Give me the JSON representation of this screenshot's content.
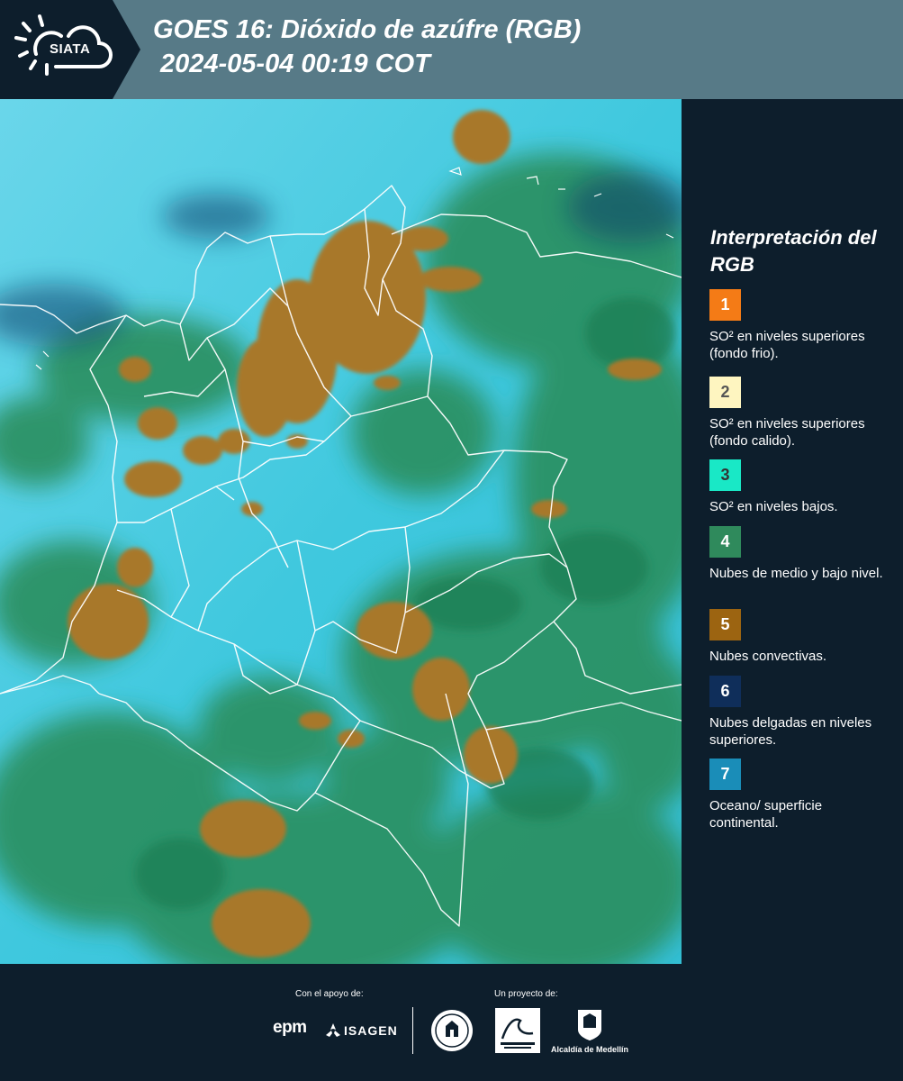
{
  "header": {
    "logo_text": "SIATA",
    "title_line1": "GOES 16: Dióxido de azúfre (RGB)",
    "title_line2": "2024-05-04 00:19 COT"
  },
  "legend": {
    "title": "Interpretación del RGB",
    "items": [
      {
        "number": "1",
        "color": "#f47b16",
        "text_color": "#ffffff",
        "label": "SO² en niveles superiores (fondo frio)."
      },
      {
        "number": "2",
        "color": "#fef5c0",
        "text_color": "#555555",
        "label": "SO² en niveles superiores (fondo calido)."
      },
      {
        "number": "3",
        "color": "#19e8c6",
        "text_color": "#333333",
        "label": "SO² en niveles bajos."
      },
      {
        "number": "4",
        "color": "#2f8a5c",
        "text_color": "#ffffff",
        "label": "Nubes de medio y bajo nivel."
      },
      {
        "number": "5",
        "color": "#9c6411",
        "text_color": "#ffffff",
        "label": "Nubes convectivas."
      },
      {
        "number": "6",
        "color": "#0f2e5a",
        "text_color": "#ffffff",
        "label": "Nubes delgadas en niveles superiores."
      },
      {
        "number": "7",
        "color": "#1a8db8",
        "text_color": "#ffffff",
        "label": "Oceano/ superficie continental."
      }
    ]
  },
  "footer": {
    "support_label": "Con el apoyo de:",
    "project_label": "Un proyecto de:",
    "epm": "epm",
    "isagen": "ISAGEN",
    "alcaldia": "Alcaldía de Medellín"
  },
  "colors": {
    "header_bg": "#577a87",
    "panel_bg": "#0d1e2c",
    "map_cyan": "#33c5dc",
    "map_green": "#2b8e5c",
    "map_convective": "#a8782a"
  }
}
